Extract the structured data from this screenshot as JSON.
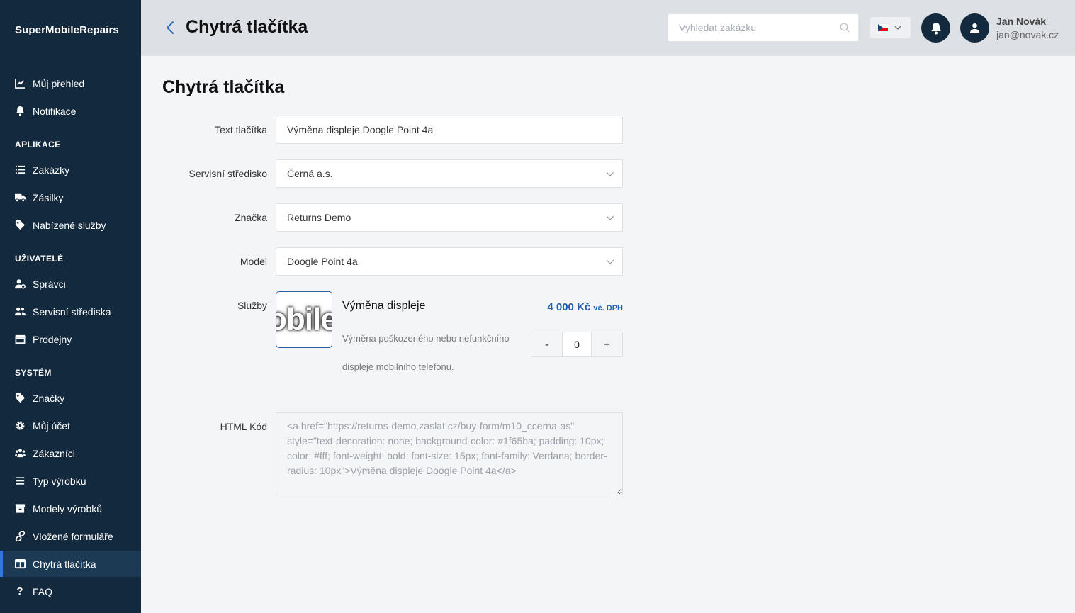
{
  "brand": "SuperMobileRepairs",
  "sidebar": {
    "top_items": [
      {
        "label": "Můj přehled",
        "icon": "chart-line-icon"
      },
      {
        "label": "Notifikace",
        "icon": "bell-icon"
      }
    ],
    "sections": [
      {
        "title": "APLIKACE",
        "items": [
          {
            "label": "Zakázky",
            "icon": "list-icon"
          },
          {
            "label": "Zásilky",
            "icon": "truck-icon"
          },
          {
            "label": "Nabízené služby",
            "icon": "tag-icon"
          }
        ]
      },
      {
        "title": "UŽIVATELÉ",
        "items": [
          {
            "label": "Správci",
            "icon": "user-gear-icon"
          },
          {
            "label": "Servisní střediska",
            "icon": "users-icon"
          },
          {
            "label": "Prodejny",
            "icon": "store-icon"
          }
        ]
      },
      {
        "title": "SYSTÉM",
        "items": [
          {
            "label": "Značky",
            "icon": "tag-icon"
          },
          {
            "label": "Můj účet",
            "icon": "gear-icon"
          },
          {
            "label": "Zákazníci",
            "icon": "user-group-icon"
          },
          {
            "label": "Typ výrobku",
            "icon": "bars-icon"
          },
          {
            "label": "Modely výrobků",
            "icon": "archive-icon"
          },
          {
            "label": "Vložené formuláře",
            "icon": "link-icon"
          },
          {
            "label": "Chytrá tlačítka",
            "icon": "table-icon",
            "active": true
          },
          {
            "label": "FAQ",
            "icon": "question-icon"
          }
        ]
      }
    ]
  },
  "header": {
    "title": "Chytrá tlačítka",
    "search_placeholder": "Vyhledat zakázku",
    "language": "cs",
    "user_name": "Jan Novák",
    "user_email": "jan@novak.cz"
  },
  "form": {
    "title": "Chytrá tlačítka",
    "button_text_label": "Text tlačítka",
    "button_text_value": "Výměna displeje Doogle Point 4a",
    "service_center_label": "Servisní středisko",
    "service_center_value": "Černá a.s.",
    "brand_label": "Značka",
    "brand_value": "Returns Demo",
    "model_label": "Model",
    "model_value": "Doogle Point 4a",
    "services_label": "Služby",
    "service": {
      "thumb_text": "obile",
      "name": "Výměna displeje",
      "description": "Výměna poškozeného nebo nefunkčního displeje mobilního telefonu.",
      "price": "4 000 Kč",
      "price_suffix": "vč. DPH",
      "minus": "-",
      "quantity": "0",
      "plus": "+"
    },
    "html_label": "HTML Kód",
    "html_code": "<a href=\"https://returns-demo.zaslat.cz/buy-form/m10_ccerna-as\" style=\"text-decoration: none; background-color: #1f65ba; padding: 10px; color: #fff; font-weight: bold; font-size: 15px; font-family: Verdana; border-radius: 10px\">Výměna displeje Doogle Point 4a</a>"
  },
  "colors": {
    "sidebar_bg": "#13293d",
    "header_bg": "#dde0e4",
    "accent": "#1f5fb0",
    "active_marker": "#2e7bd6"
  }
}
